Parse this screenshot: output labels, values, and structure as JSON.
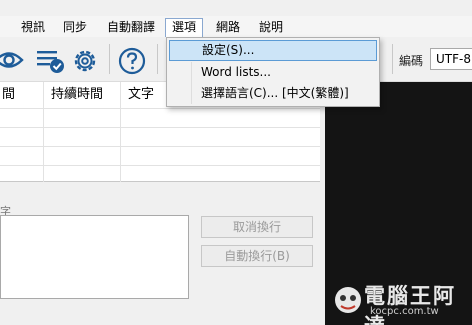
{
  "menubar": {
    "items": [
      {
        "label": "視訊"
      },
      {
        "label": "同步"
      },
      {
        "label": "自動翻譯"
      },
      {
        "label": "選項"
      },
      {
        "label": "網路"
      },
      {
        "label": "說明"
      }
    ]
  },
  "options_menu": {
    "items": [
      {
        "label": "設定(S)..."
      },
      {
        "label": "Word lists..."
      },
      {
        "label": "選擇語言(C)... [中文(繁體)]"
      }
    ]
  },
  "toolbar": {
    "icons": [
      "eye-icon",
      "list-check-icon",
      "gear-icon",
      "help-icon"
    ],
    "encoding_label": "編碼",
    "encoding_value": "UTF-8"
  },
  "grid": {
    "columns": [
      "間",
      "持續時間",
      "文字"
    ]
  },
  "editor": {
    "section_label": "字",
    "undo_line_button": "取消換行",
    "auto_wrap_button": "自動換行(B)"
  },
  "watermark": {
    "text": "電腦王阿達",
    "url": "kocpc.com.tw"
  },
  "colors": {
    "menu_highlight": "#cce4f7",
    "menu_highlight_border": "#5b9bd5",
    "icon_blue": "#1e5c99",
    "video_background": "#141414"
  }
}
